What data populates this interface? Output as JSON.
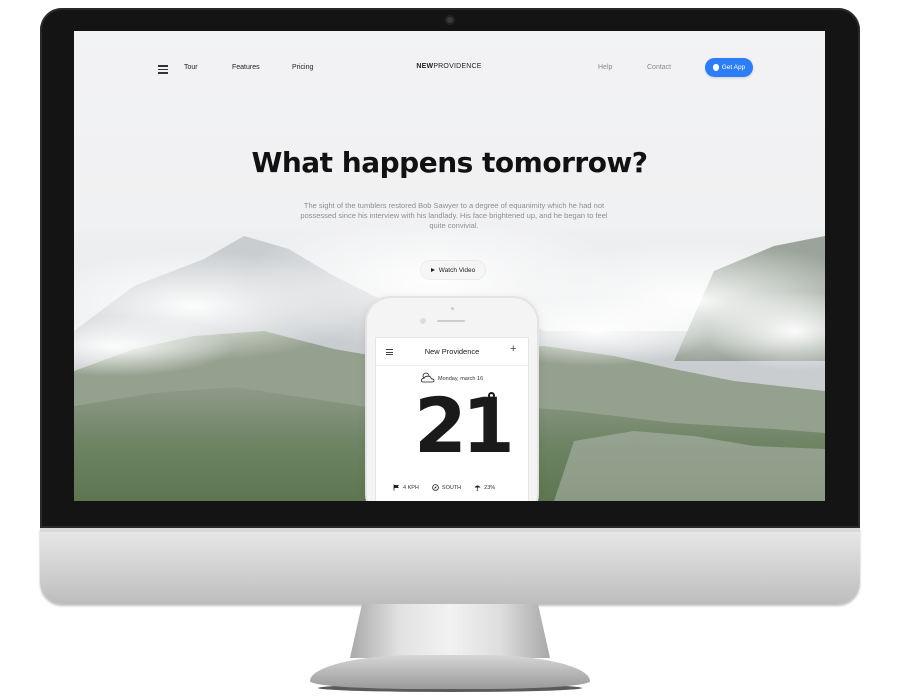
{
  "site": {
    "nav": {
      "left_links": [
        "Tour",
        "Features",
        "Pricing"
      ],
      "right_links": [
        "Help",
        "Contact"
      ],
      "cta_label": "Get App"
    },
    "logo": {
      "bold": "NEW",
      "light": "PROVIDENCE"
    },
    "hero": {
      "title": "What happens tomorrow?",
      "body": "The sight of the tumblers restored Bob Sawyer to a degree of equanimity which he had not possessed since his interview with his landlady. His face brightened up, and he began to feel quite convivial.",
      "watch_video_label": "Watch Video"
    },
    "phone_app": {
      "title": "New Providence",
      "date": "Monday, march 16",
      "temperature": "21",
      "stats": {
        "wind": "4 KPH",
        "direction": "SOUTH",
        "rain": "23%"
      }
    },
    "colors": {
      "accent": "#2d7df6",
      "title": "#111111",
      "body_text": "#8c8f93"
    }
  }
}
